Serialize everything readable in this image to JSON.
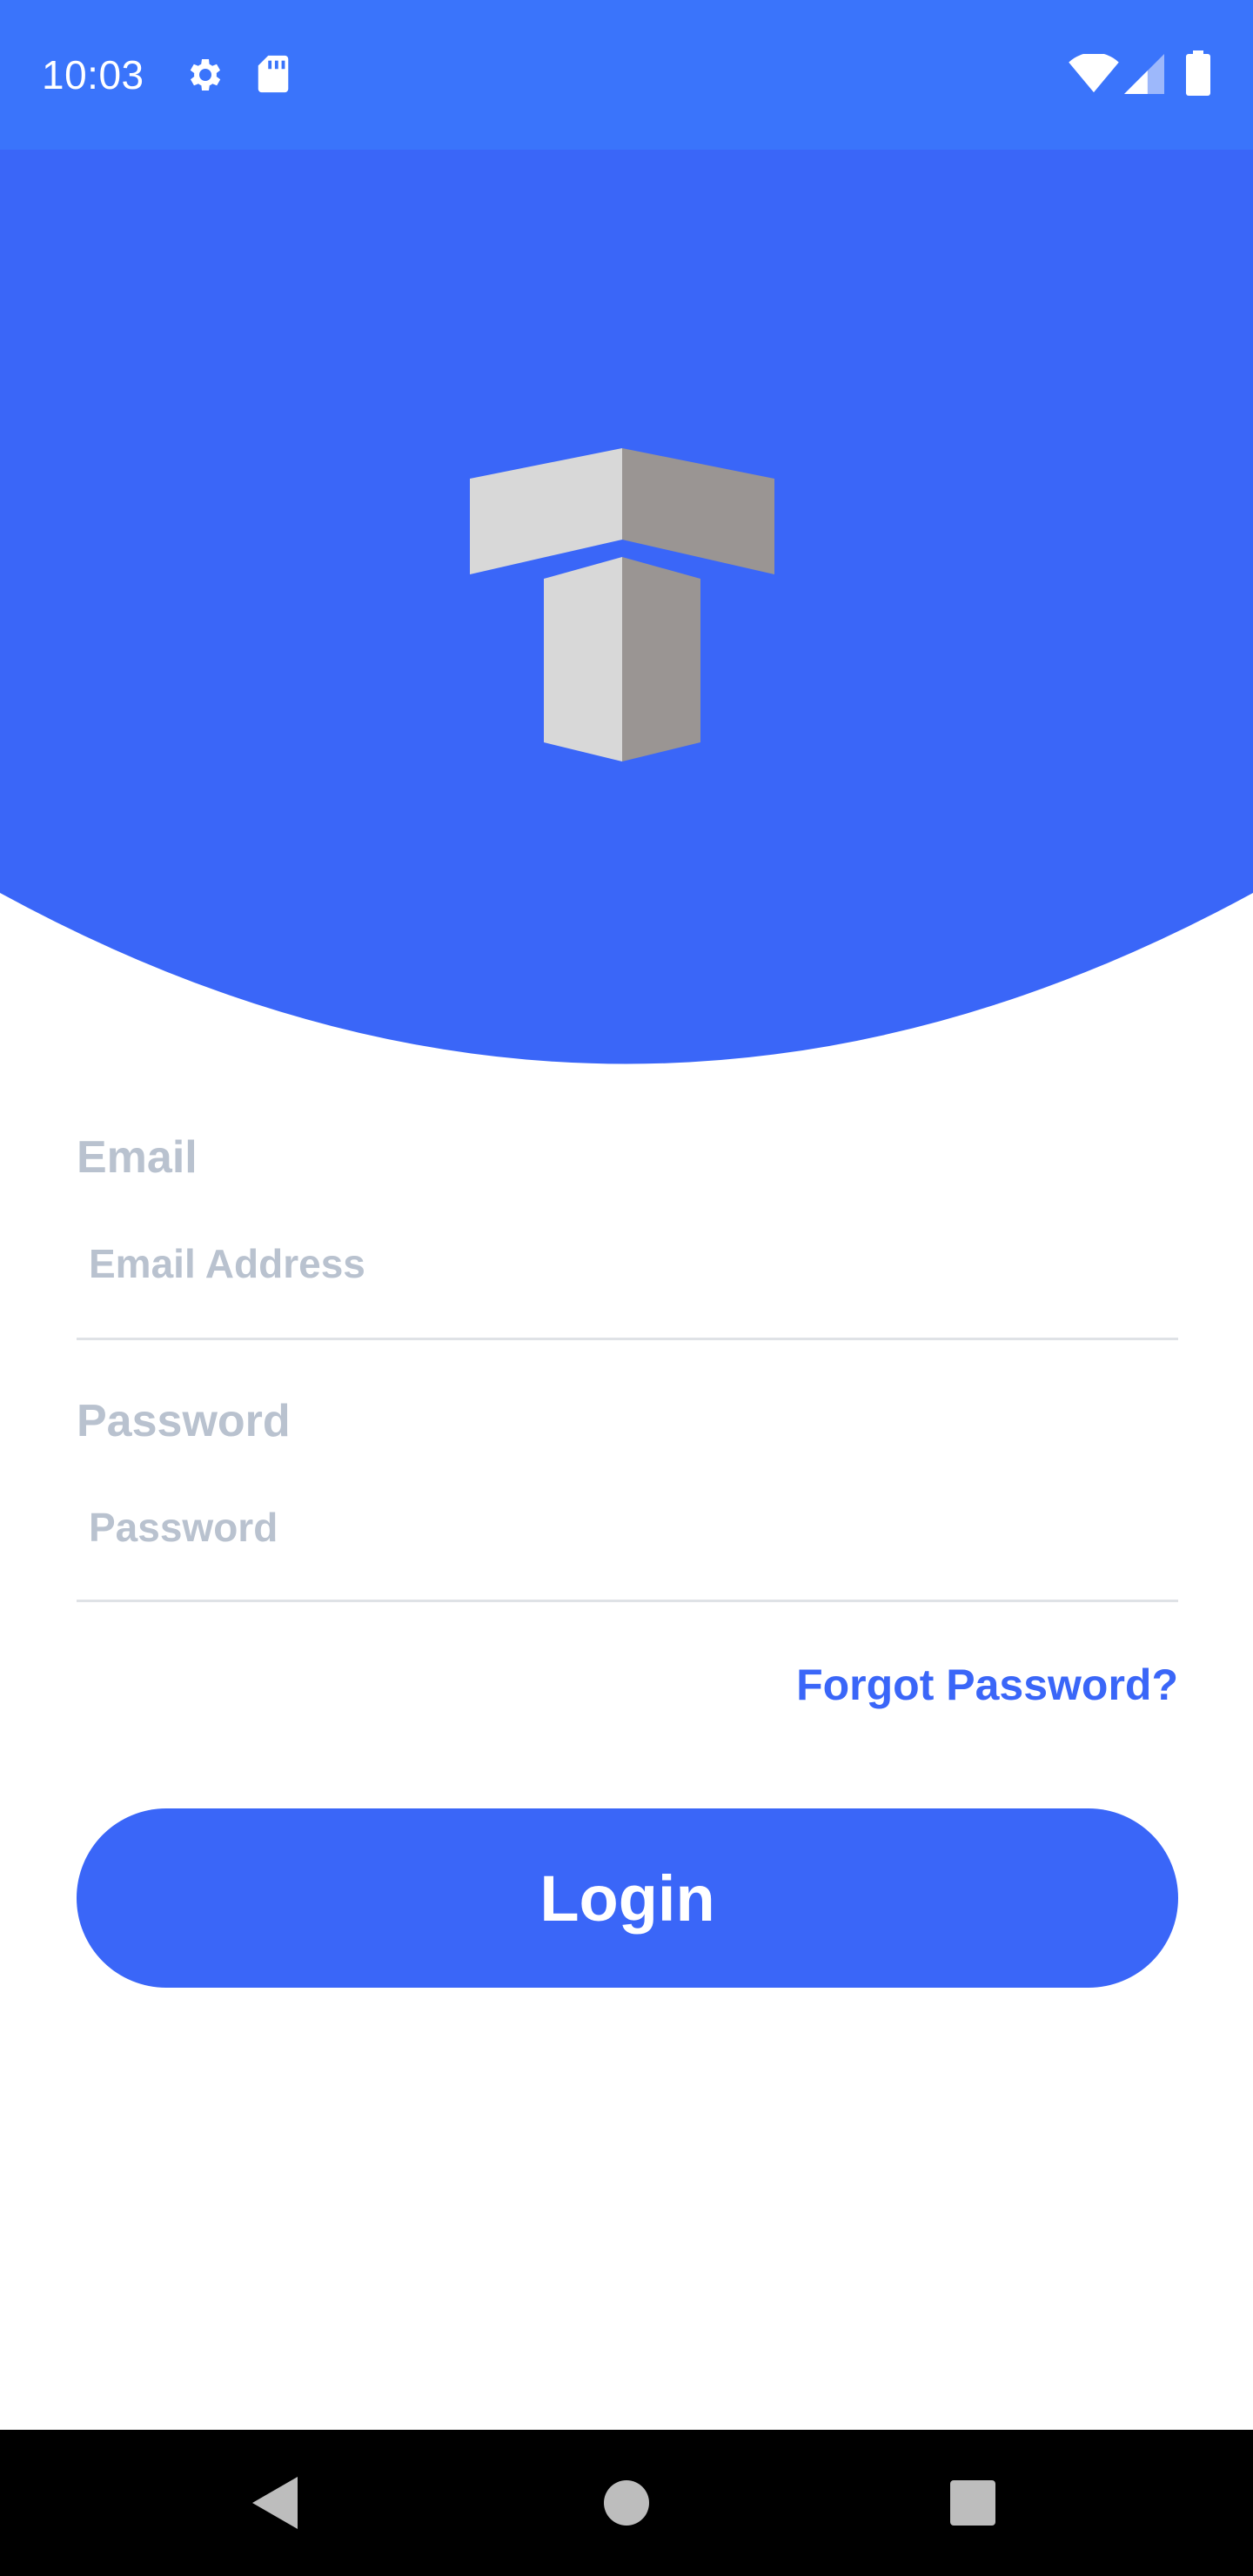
{
  "status_bar": {
    "time": "10:03",
    "icons": [
      "gear-icon",
      "sd-card-icon",
      "wifi-icon",
      "signal-icon",
      "battery-icon"
    ],
    "background": "#3a74fb"
  },
  "hero": {
    "background": "#3a66f8",
    "logo": "stacked-block-logo"
  },
  "form": {
    "email_label": "Email",
    "email_placeholder": "Email Address",
    "email_value": "",
    "password_label": "Password",
    "password_placeholder": "Password",
    "password_value": "",
    "forgot_label": "Forgot Password?",
    "login_label": "Login"
  },
  "colors": {
    "primary": "#3a66f8",
    "label": "#b9c2cf",
    "divider": "#dfe2e6"
  },
  "nav_bar": {
    "buttons": [
      "back-icon",
      "home-icon",
      "recents-icon"
    ]
  }
}
